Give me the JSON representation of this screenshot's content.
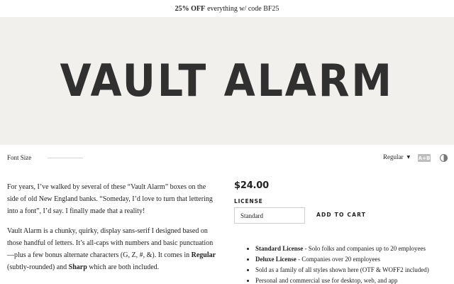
{
  "promo": {
    "highlight": "25% OFF",
    "text": "everything w/ code BF25"
  },
  "hero": {
    "specimen_text": "VAULT ALARM"
  },
  "controls": {
    "font_size_label": "Font Size",
    "font_size_value": 0.0,
    "style_selected": "Regular",
    "glyph_toggle_label": "A+B",
    "icons": {
      "style_dropdown": "chevron-down-icon",
      "theme_toggle": "contrast-icon"
    }
  },
  "description": {
    "paragraph1": "For years, I’ve walked by several of these “Vault Alarm” boxes on the side of old New England banks. “Someday, I’d love to turn that lettering into a font”, I’d say. I finally made that a reality!",
    "paragraph2_intro": "Vault Alarm is a chunky, quirky, display sans-serif I designed based on those handful of letters. It’s all-caps with numbers and basic punctuation—plus a few bonus alternate characters (G, Z, #, &). It comes in ",
    "regular": "Regular",
    "paragraph2_mid": " (subtly-rounded) and ",
    "sharp": "Sharp",
    "paragraph2_end": " which are both included."
  },
  "purchase": {
    "price": "$24.00",
    "license_label": "LICENSE",
    "license_selected": "Standard",
    "add_to_cart_label": "ADD TO CART"
  },
  "features": [
    {
      "bold": "Standard License",
      "text": " - Solo folks and companies up to 20 employees"
    },
    {
      "bold": "Deluxe License",
      "text": " - Companies over 20 employees"
    },
    {
      "bold": "",
      "text": "Sold as a family of all styles shown here (OTF & WOFF2 included)"
    },
    {
      "bold": "",
      "text": "Personal and commercial use for desktop, web, and app"
    }
  ],
  "colors": {
    "hero_background": "#f1f0ec",
    "text": "#222222",
    "glyph_toggle_bg": "#bdbdbd"
  }
}
